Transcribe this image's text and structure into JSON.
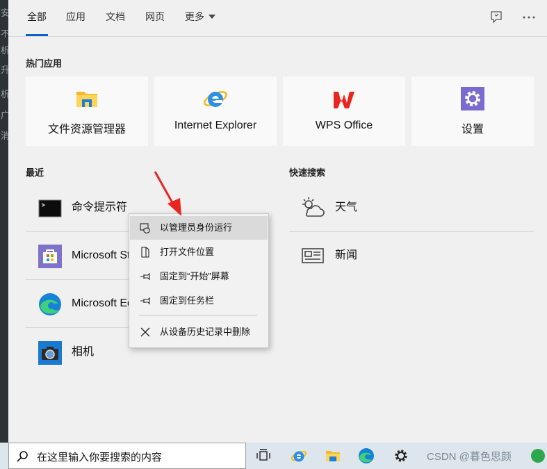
{
  "desktop_strip": {
    "chars": [
      "安",
      "不",
      "析",
      "升",
      "析",
      "广",
      "消"
    ]
  },
  "tabs": [
    {
      "label": "全部",
      "active": true
    },
    {
      "label": "应用",
      "active": false
    },
    {
      "label": "文档",
      "active": false
    },
    {
      "label": "网页",
      "active": false
    },
    {
      "label": "更多",
      "active": false,
      "has_dropdown": true
    }
  ],
  "top_icons": [
    "feedback-icon",
    "more-options-icon"
  ],
  "hot_apps": {
    "title": "热门应用",
    "items": [
      {
        "label": "文件资源管理器",
        "icon": "file-explorer-icon"
      },
      {
        "label": "Internet Explorer",
        "icon": "internet-explorer-icon"
      },
      {
        "label": "WPS Office",
        "icon": "wps-office-icon"
      },
      {
        "label": "设置",
        "icon": "settings-gear-icon"
      }
    ]
  },
  "recent": {
    "title": "最近",
    "items": [
      {
        "label": "命令提示符",
        "icon": "command-prompt-icon"
      },
      {
        "label": "Microsoft Store",
        "icon": "microsoft-store-icon"
      },
      {
        "label": "Microsoft Edge",
        "icon": "microsoft-edge-icon"
      },
      {
        "label": "相机",
        "icon": "camera-icon"
      }
    ]
  },
  "quick_search": {
    "title": "快速搜索",
    "items": [
      {
        "label": "天气",
        "icon": "weather-icon"
      },
      {
        "label": "新闻",
        "icon": "news-icon"
      }
    ]
  },
  "context_menu": {
    "items": [
      {
        "label": "以管理员身份运行",
        "icon": "run-as-admin-icon",
        "highlighted": true
      },
      {
        "label": "打开文件位置",
        "icon": "open-file-location-icon"
      },
      {
        "label": "固定到“开始”屏幕",
        "icon": "pin-icon"
      },
      {
        "label": "固定到任务栏",
        "icon": "pin-icon"
      },
      {
        "label": "从设备历史记录中删除",
        "icon": "close-icon"
      }
    ]
  },
  "taskbar": {
    "search_value": "在这里输入你要搜索的内容",
    "icons": [
      "task-view-icon",
      "internet-explorer-icon",
      "file-explorer-icon",
      "microsoft-edge-icon",
      "settings-gear-icon"
    ],
    "watermark": "CSDN @暮色思颜"
  },
  "colors": {
    "accent": "#0a64c8",
    "annotation": "#e8251e"
  }
}
